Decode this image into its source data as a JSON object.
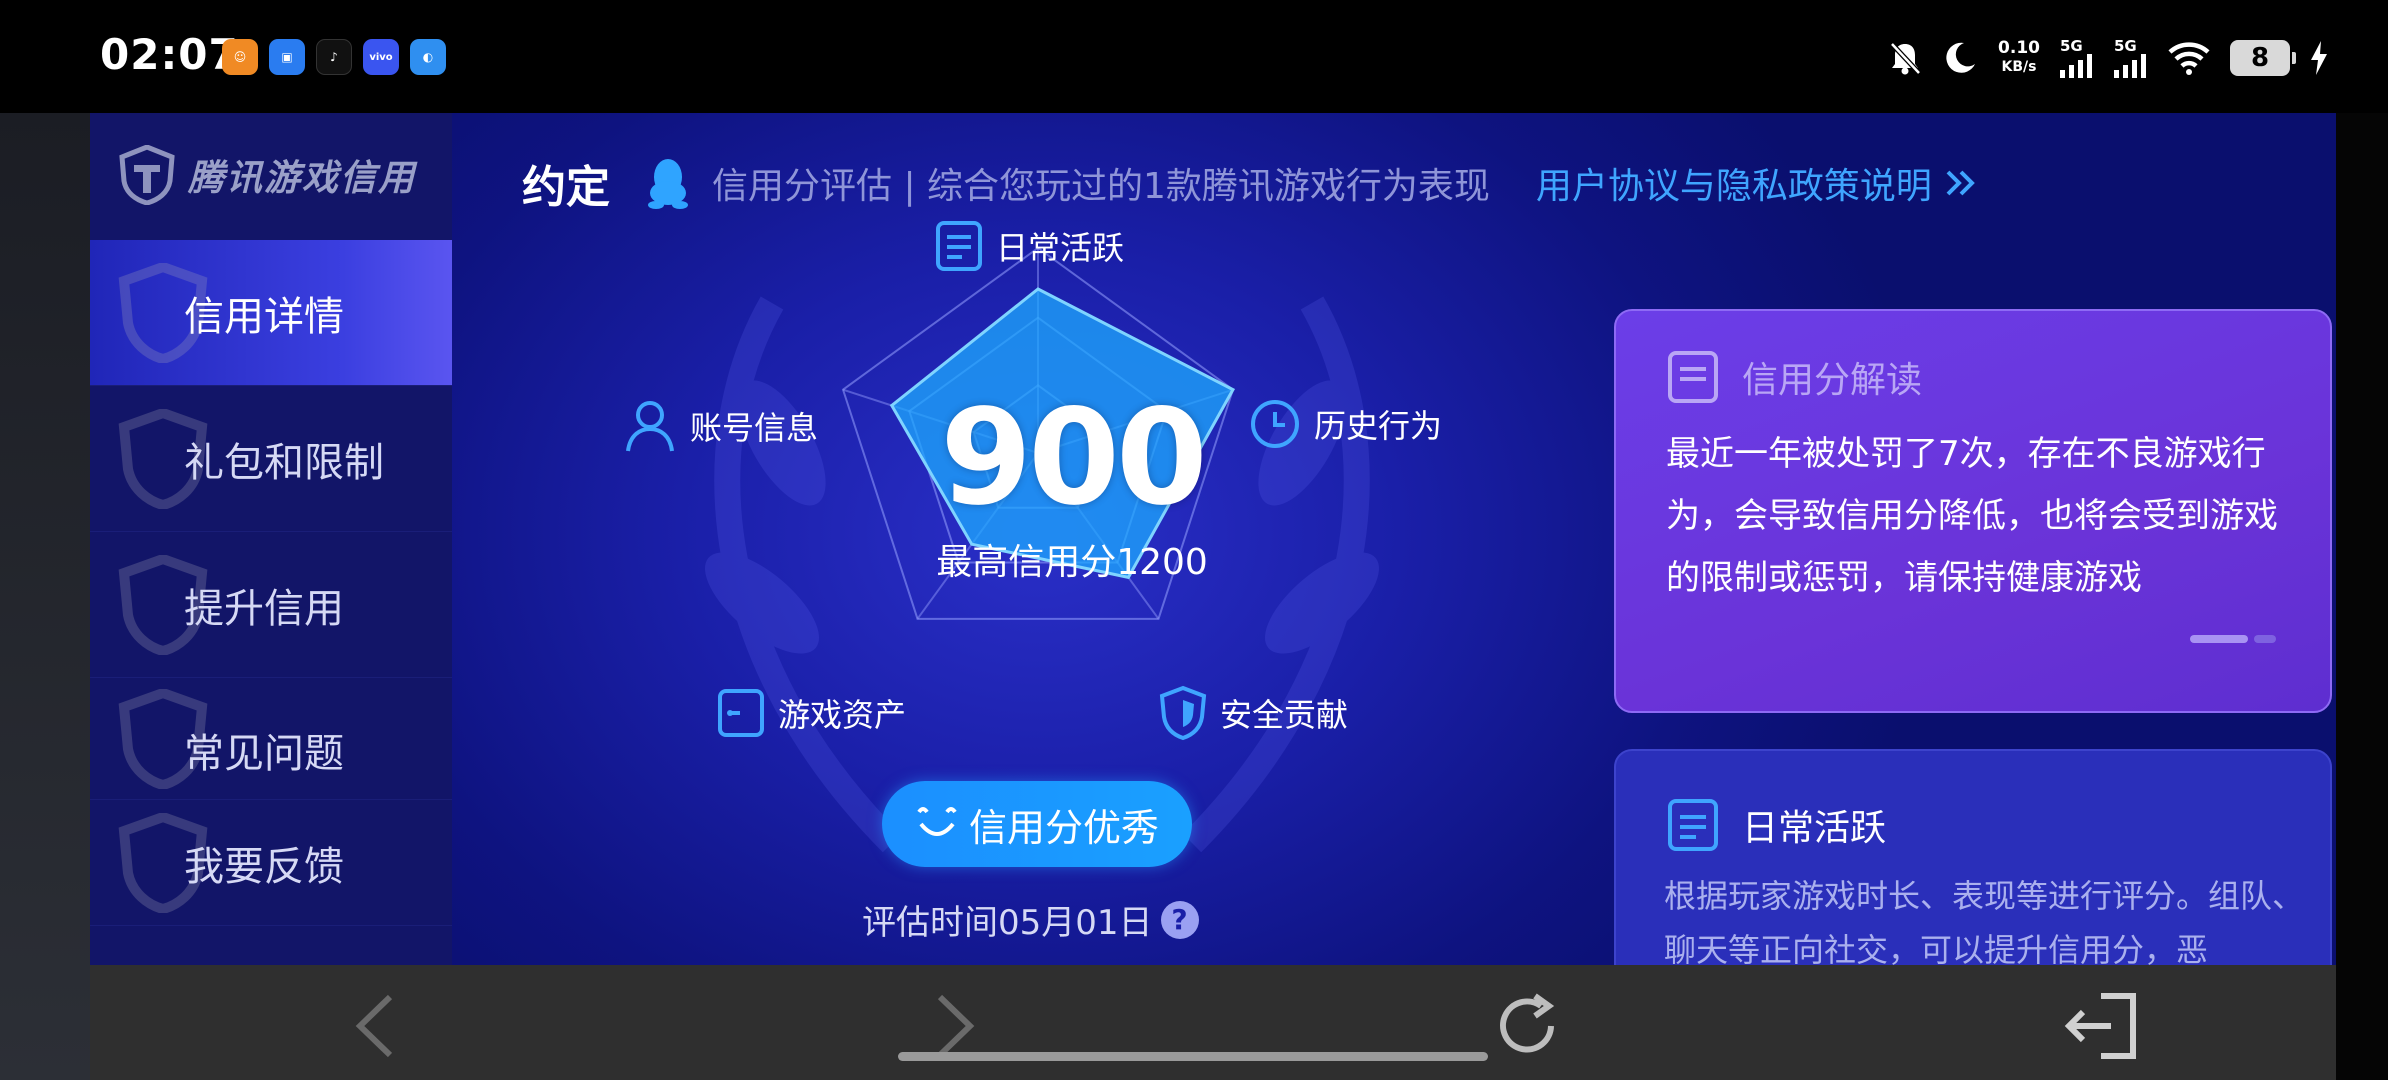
{
  "status_bar": {
    "time": "02:07",
    "net_speed_value": "0.10",
    "net_speed_unit": "KB/s",
    "signal1_label": "5G",
    "signal2_label": "5G",
    "battery": "8",
    "app_icons": [
      "game-app-icon",
      "chat-app-icon",
      "tiktok-icon",
      "vivo-icon",
      "files-icon"
    ]
  },
  "sidebar": {
    "logo_text": "腾讯游戏信用",
    "items": [
      {
        "label": "信用详情",
        "active": true
      },
      {
        "label": "礼包和限制",
        "active": false
      },
      {
        "label": "提升信用",
        "active": false
      },
      {
        "label": "常见问题",
        "active": false
      },
      {
        "label": "我要反馈",
        "active": false
      }
    ]
  },
  "header": {
    "title": "约定",
    "description": "信用分评估 | 综合您玩过的1款腾讯游戏行为表现",
    "link": "用户协议与隐私政策说明"
  },
  "radar": {
    "score": "900",
    "max_label": "最高信用分1200",
    "dimensions": {
      "daily": "日常活跃",
      "history": "历史行为",
      "security": "安全贡献",
      "assets": "游戏资产",
      "account": "账号信息"
    },
    "levels": {
      "daily": 0.8,
      "history": 1.0,
      "security": 0.75,
      "assets": 0.55,
      "account": 0.75
    },
    "badge": "信用分优秀",
    "eval_time": "评估时间05月01日"
  },
  "cards": {
    "interpretation": {
      "title": "信用分解读",
      "body": "最近一年被处罚了7次，存在不良游戏行为，会导致信用分降低，也将会受到游戏的限制或惩罚，请保持健康游戏"
    },
    "daily": {
      "title": "日常活跃",
      "body": "根据玩家游戏时长、表现等进行评分。组队、聊天等正向社交，可以提升信用分，恶"
    }
  },
  "colors": {
    "accent_blue": "#1aa0ff",
    "link_blue": "#3fa5ff",
    "card_purple": "#6a33d8",
    "bg_blue": "#1a1fa8"
  }
}
